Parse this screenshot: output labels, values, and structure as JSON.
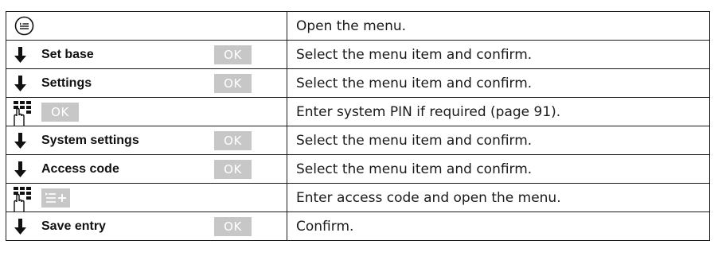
{
  "rows": [
    {
      "left_icon": "menu-key-icon",
      "left_label": "",
      "left_chip": "",
      "instruction": "Open the menu."
    },
    {
      "left_icon": "arrow-down-icon",
      "left_label": "Set base",
      "left_chip": "OK",
      "instruction": "Select the menu item and confirm."
    },
    {
      "left_icon": "arrow-down-icon",
      "left_label": "Settings",
      "left_chip": "OK",
      "instruction": "Select the menu item and confirm."
    },
    {
      "left_icon": "keypad-icon",
      "left_label": "",
      "left_chip": "OK",
      "instruction": "Enter system PIN if required (page 91)."
    },
    {
      "left_icon": "arrow-down-icon",
      "left_label": "System settings",
      "left_chip": "OK",
      "instruction": "Select the menu item and confirm."
    },
    {
      "left_icon": "arrow-down-icon",
      "left_label": "Access code",
      "left_chip": "OK",
      "instruction": "Select the menu item and confirm."
    },
    {
      "left_icon": "keypad-icon",
      "left_label": "",
      "left_chip": "menu-plus-icon",
      "instruction": "Enter access code and open the menu."
    },
    {
      "left_icon": "arrow-down-icon",
      "left_label": "Save entry",
      "left_chip": "OK",
      "instruction": "Confirm."
    }
  ],
  "colors": {
    "chip_background": "#c7c7c7",
    "chip_text": "#ffffff",
    "border": "#1a1a1a"
  }
}
